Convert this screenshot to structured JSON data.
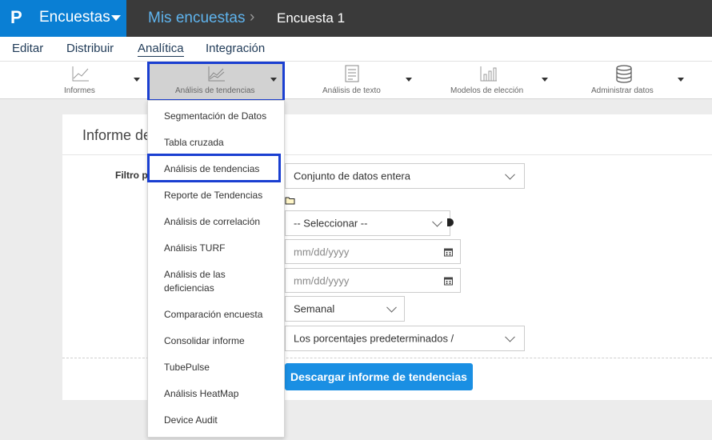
{
  "header": {
    "logo": "P",
    "app_name": "Encuestas",
    "breadcrumb_1": "Mis encuestas",
    "breadcrumb_sep": "›",
    "breadcrumb_2": "Encuesta 1"
  },
  "menu": {
    "items": [
      "Editar",
      "Distribuir",
      "Analítica",
      "Integración"
    ],
    "active": "Analítica"
  },
  "toolbar": {
    "items": [
      {
        "label": "Informes",
        "icon": "line-chart-icon"
      },
      {
        "label": "Análisis de tendencias",
        "icon": "trend-chart-icon"
      },
      {
        "label": "Análisis de texto",
        "icon": "text-doc-icon"
      },
      {
        "label": "Modelos de elección",
        "icon": "bar-chart-icon"
      },
      {
        "label": "Administrar datos",
        "icon": "database-icon"
      }
    ],
    "selected": "Análisis de tendencias"
  },
  "panel": {
    "title": "Informe de",
    "filter_label": "Filtro pa",
    "dataset_select": "Conjunto de datos entera",
    "folder_icon": "folder-icon",
    "select_placeholder": "-- Seleccionar --",
    "date_from_placeholder": "mm/dd/yyyy",
    "date_to_placeholder": "mm/dd/yyyy",
    "interval_select": "Semanal",
    "percent_select": "Los porcentajes predeterminados /",
    "download_button": "Descargar informe de tendencias"
  },
  "dropdown": {
    "items": [
      "Segmentación de Datos",
      "Tabla cruzada",
      "Análisis de tendencias",
      "Reporte de Tendencias",
      "Análisis de correlación",
      "Análisis TURF",
      "Análisis de las deficiencias",
      "Comparación encuesta",
      "Consolidar informe",
      "TubePulse",
      "Análisis HeatMap",
      "Device Audit"
    ],
    "highlighted": "Análisis de tendencias"
  },
  "colors": {
    "brand_blue": "#0a7fd4",
    "topbar_dark": "#3a3a3a",
    "highlight_border": "#1a3fd1",
    "button_blue": "#1a8fe3"
  }
}
